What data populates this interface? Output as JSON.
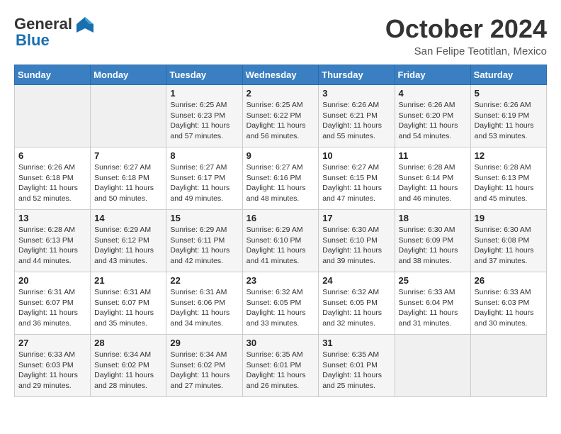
{
  "header": {
    "logo_general": "General",
    "logo_blue": "Blue",
    "month_title": "October 2024",
    "location": "San Felipe Teotitlan, Mexico"
  },
  "days_of_week": [
    "Sunday",
    "Monday",
    "Tuesday",
    "Wednesday",
    "Thursday",
    "Friday",
    "Saturday"
  ],
  "weeks": [
    [
      {
        "day": "",
        "info": ""
      },
      {
        "day": "",
        "info": ""
      },
      {
        "day": "1",
        "info": "Sunrise: 6:25 AM\nSunset: 6:23 PM\nDaylight: 11 hours and 57 minutes."
      },
      {
        "day": "2",
        "info": "Sunrise: 6:25 AM\nSunset: 6:22 PM\nDaylight: 11 hours and 56 minutes."
      },
      {
        "day": "3",
        "info": "Sunrise: 6:26 AM\nSunset: 6:21 PM\nDaylight: 11 hours and 55 minutes."
      },
      {
        "day": "4",
        "info": "Sunrise: 6:26 AM\nSunset: 6:20 PM\nDaylight: 11 hours and 54 minutes."
      },
      {
        "day": "5",
        "info": "Sunrise: 6:26 AM\nSunset: 6:19 PM\nDaylight: 11 hours and 53 minutes."
      }
    ],
    [
      {
        "day": "6",
        "info": "Sunrise: 6:26 AM\nSunset: 6:18 PM\nDaylight: 11 hours and 52 minutes."
      },
      {
        "day": "7",
        "info": "Sunrise: 6:27 AM\nSunset: 6:18 PM\nDaylight: 11 hours and 50 minutes."
      },
      {
        "day": "8",
        "info": "Sunrise: 6:27 AM\nSunset: 6:17 PM\nDaylight: 11 hours and 49 minutes."
      },
      {
        "day": "9",
        "info": "Sunrise: 6:27 AM\nSunset: 6:16 PM\nDaylight: 11 hours and 48 minutes."
      },
      {
        "day": "10",
        "info": "Sunrise: 6:27 AM\nSunset: 6:15 PM\nDaylight: 11 hours and 47 minutes."
      },
      {
        "day": "11",
        "info": "Sunrise: 6:28 AM\nSunset: 6:14 PM\nDaylight: 11 hours and 46 minutes."
      },
      {
        "day": "12",
        "info": "Sunrise: 6:28 AM\nSunset: 6:13 PM\nDaylight: 11 hours and 45 minutes."
      }
    ],
    [
      {
        "day": "13",
        "info": "Sunrise: 6:28 AM\nSunset: 6:13 PM\nDaylight: 11 hours and 44 minutes."
      },
      {
        "day": "14",
        "info": "Sunrise: 6:29 AM\nSunset: 6:12 PM\nDaylight: 11 hours and 43 minutes."
      },
      {
        "day": "15",
        "info": "Sunrise: 6:29 AM\nSunset: 6:11 PM\nDaylight: 11 hours and 42 minutes."
      },
      {
        "day": "16",
        "info": "Sunrise: 6:29 AM\nSunset: 6:10 PM\nDaylight: 11 hours and 41 minutes."
      },
      {
        "day": "17",
        "info": "Sunrise: 6:30 AM\nSunset: 6:10 PM\nDaylight: 11 hours and 39 minutes."
      },
      {
        "day": "18",
        "info": "Sunrise: 6:30 AM\nSunset: 6:09 PM\nDaylight: 11 hours and 38 minutes."
      },
      {
        "day": "19",
        "info": "Sunrise: 6:30 AM\nSunset: 6:08 PM\nDaylight: 11 hours and 37 minutes."
      }
    ],
    [
      {
        "day": "20",
        "info": "Sunrise: 6:31 AM\nSunset: 6:07 PM\nDaylight: 11 hours and 36 minutes."
      },
      {
        "day": "21",
        "info": "Sunrise: 6:31 AM\nSunset: 6:07 PM\nDaylight: 11 hours and 35 minutes."
      },
      {
        "day": "22",
        "info": "Sunrise: 6:31 AM\nSunset: 6:06 PM\nDaylight: 11 hours and 34 minutes."
      },
      {
        "day": "23",
        "info": "Sunrise: 6:32 AM\nSunset: 6:05 PM\nDaylight: 11 hours and 33 minutes."
      },
      {
        "day": "24",
        "info": "Sunrise: 6:32 AM\nSunset: 6:05 PM\nDaylight: 11 hours and 32 minutes."
      },
      {
        "day": "25",
        "info": "Sunrise: 6:33 AM\nSunset: 6:04 PM\nDaylight: 11 hours and 31 minutes."
      },
      {
        "day": "26",
        "info": "Sunrise: 6:33 AM\nSunset: 6:03 PM\nDaylight: 11 hours and 30 minutes."
      }
    ],
    [
      {
        "day": "27",
        "info": "Sunrise: 6:33 AM\nSunset: 6:03 PM\nDaylight: 11 hours and 29 minutes."
      },
      {
        "day": "28",
        "info": "Sunrise: 6:34 AM\nSunset: 6:02 PM\nDaylight: 11 hours and 28 minutes."
      },
      {
        "day": "29",
        "info": "Sunrise: 6:34 AM\nSunset: 6:02 PM\nDaylight: 11 hours and 27 minutes."
      },
      {
        "day": "30",
        "info": "Sunrise: 6:35 AM\nSunset: 6:01 PM\nDaylight: 11 hours and 26 minutes."
      },
      {
        "day": "31",
        "info": "Sunrise: 6:35 AM\nSunset: 6:01 PM\nDaylight: 11 hours and 25 minutes."
      },
      {
        "day": "",
        "info": ""
      },
      {
        "day": "",
        "info": ""
      }
    ]
  ]
}
